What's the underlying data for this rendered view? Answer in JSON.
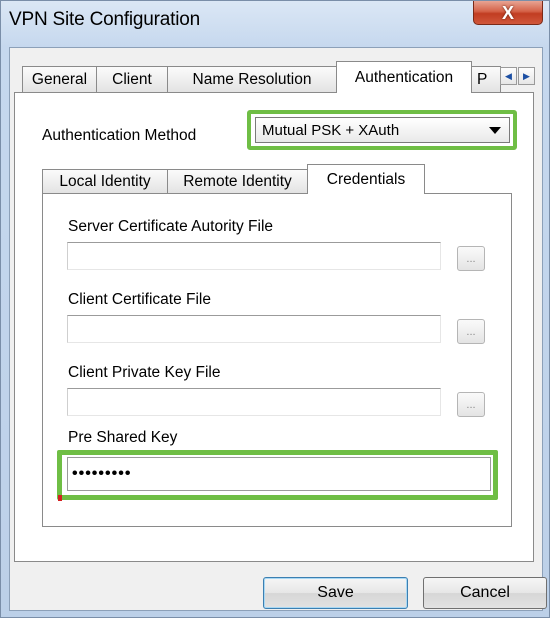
{
  "window": {
    "title": "VPN Site Configuration",
    "close_label": "X"
  },
  "tabs": [
    {
      "label": "General"
    },
    {
      "label": "Client"
    },
    {
      "label": "Name Resolution"
    },
    {
      "label": "Authentication"
    },
    {
      "label": "P"
    }
  ],
  "tab_scroll": {
    "left": "◀",
    "right": "▶"
  },
  "auth": {
    "label": "Authentication Method",
    "selected": "Mutual PSK + XAuth"
  },
  "inner_tabs": [
    {
      "label": "Local Identity"
    },
    {
      "label": "Remote Identity"
    },
    {
      "label": "Credentials"
    }
  ],
  "fields": {
    "server_cert": {
      "label": "Server Certificate Autority File",
      "value": "",
      "browse": "..."
    },
    "client_cert": {
      "label": "Client Certificate File",
      "value": "",
      "browse": "..."
    },
    "client_key": {
      "label": "Client Private Key File",
      "value": "",
      "browse": "..."
    },
    "psk": {
      "label": "Pre Shared Key",
      "value": "•••••••••"
    }
  },
  "buttons": {
    "save": "Save",
    "cancel": "Cancel"
  },
  "colors": {
    "highlight": "#6fbe45"
  }
}
